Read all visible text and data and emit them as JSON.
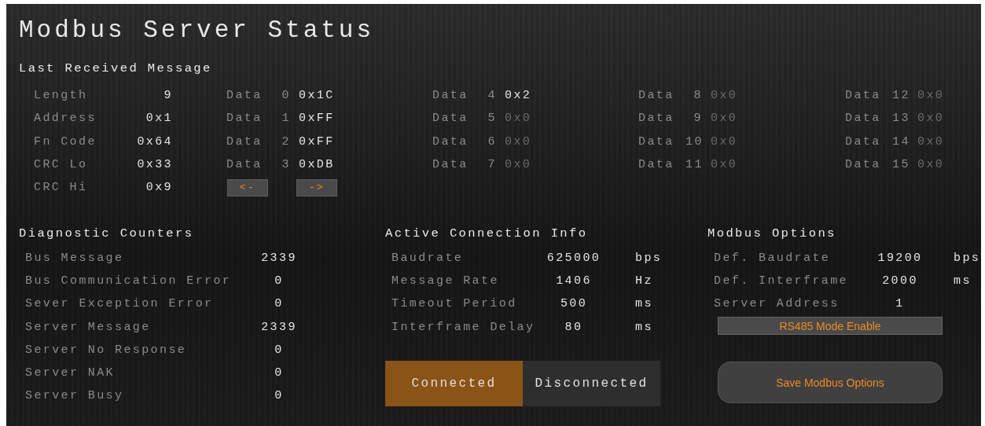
{
  "title": "Modbus Server Status",
  "last_message": {
    "heading": "Last Received Message",
    "fields": [
      {
        "label": "Length",
        "value": "9"
      },
      {
        "label": "Address",
        "value": "0x1"
      },
      {
        "label": "Fn Code",
        "value": "0x64"
      },
      {
        "label": "CRC Lo",
        "value": "0x33"
      },
      {
        "label": "CRC Hi",
        "value": "0x9"
      }
    ],
    "data": [
      {
        "label": "Data",
        "index": "0",
        "value": "0x1C",
        "dimmed": false
      },
      {
        "label": "Data",
        "index": "1",
        "value": "0xFF",
        "dimmed": false
      },
      {
        "label": "Data",
        "index": "2",
        "value": "0xFF",
        "dimmed": false
      },
      {
        "label": "Data",
        "index": "3",
        "value": "0xDB",
        "dimmed": false
      },
      {
        "label": "Data",
        "index": "4",
        "value": "0x2",
        "dimmed": false
      },
      {
        "label": "Data",
        "index": "5",
        "value": "0x0",
        "dimmed": true
      },
      {
        "label": "Data",
        "index": "6",
        "value": "0x0",
        "dimmed": true
      },
      {
        "label": "Data",
        "index": "7",
        "value": "0x0",
        "dimmed": true
      },
      {
        "label": "Data",
        "index": "8",
        "value": "0x0",
        "dimmed": true
      },
      {
        "label": "Data",
        "index": "9",
        "value": "0x0",
        "dimmed": true
      },
      {
        "label": "Data",
        "index": "10",
        "value": "0x0",
        "dimmed": true
      },
      {
        "label": "Data",
        "index": "11",
        "value": "0x0",
        "dimmed": true
      },
      {
        "label": "Data",
        "index": "12",
        "value": "0x0",
        "dimmed": true
      },
      {
        "label": "Data",
        "index": "13",
        "value": "0x0",
        "dimmed": true
      },
      {
        "label": "Data",
        "index": "14",
        "value": "0x0",
        "dimmed": true
      },
      {
        "label": "Data",
        "index": "15",
        "value": "0x0",
        "dimmed": true
      }
    ],
    "prev_button": "<-",
    "next_button": "->"
  },
  "diagnostic": {
    "heading": "Diagnostic Counters",
    "rows": [
      {
        "label": "Bus Message",
        "value": "2339"
      },
      {
        "label": "Bus Communication Error",
        "value": "0"
      },
      {
        "label": "Sever Exception Error",
        "value": "0"
      },
      {
        "label": "Server Message",
        "value": "2339"
      },
      {
        "label": "Server No Response",
        "value": "0"
      },
      {
        "label": "Server NAK",
        "value": "0"
      },
      {
        "label": "Server Busy",
        "value": "0"
      }
    ]
  },
  "connection": {
    "heading": "Active Connection Info",
    "rows": [
      {
        "label": "Baudrate",
        "value": "625000",
        "unit": "bps"
      },
      {
        "label": "Message Rate",
        "value": "1406",
        "unit": "Hz"
      },
      {
        "label": "Timeout Period",
        "value": "500",
        "unit": "ms"
      },
      {
        "label": "Interframe Delay",
        "value": "80",
        "unit": "ms"
      }
    ],
    "states": [
      {
        "label": "Connected",
        "selected": true
      },
      {
        "label": "Disconnected",
        "selected": false
      }
    ]
  },
  "options": {
    "heading": "Modbus Options",
    "rows": [
      {
        "label": "Def. Baudrate",
        "value": "19200",
        "unit": "bps"
      },
      {
        "label": "Def. Interframe",
        "value": "2000",
        "unit": "ms"
      },
      {
        "label": "Server Address",
        "value": "1"
      }
    ],
    "mode_button": "RS485 Mode Enable",
    "save_button": "Save Modbus Options"
  }
}
